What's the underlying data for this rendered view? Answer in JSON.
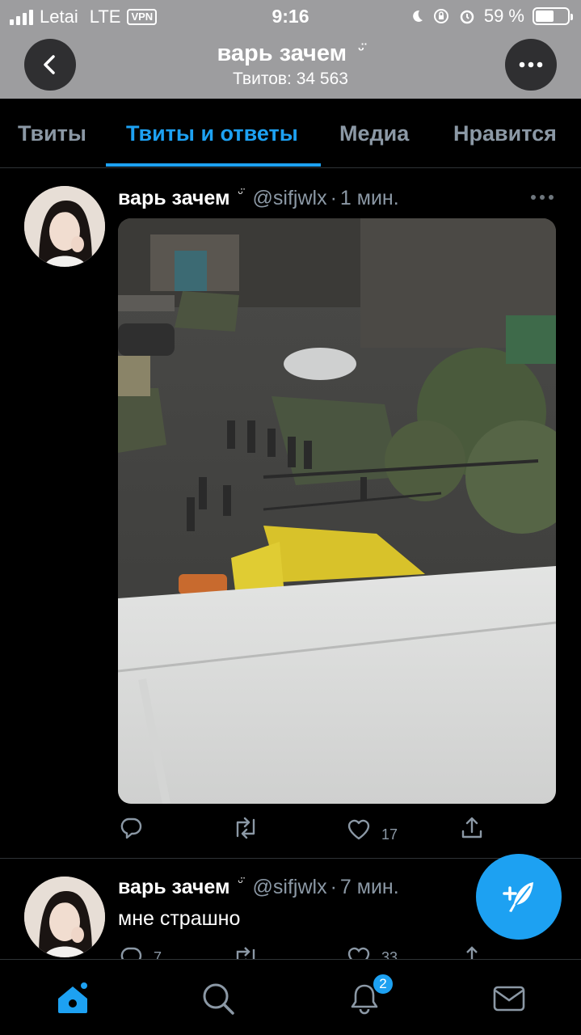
{
  "status_bar": {
    "carrier": "Letai",
    "network": "LTE",
    "vpn": "VPN",
    "time": "9:16",
    "battery": "59 %",
    "battery_level": 0.59
  },
  "header": {
    "title": "варь зачем",
    "title_badge": "ᵕ̈",
    "subtitle": "Твитов: 34 563"
  },
  "tabs": [
    {
      "label": "Твиты"
    },
    {
      "label": "Твиты и ответы",
      "active": true
    },
    {
      "label": "Медиа"
    },
    {
      "label": "Нравится"
    }
  ],
  "tweets": [
    {
      "name": "варь зачем",
      "badge": "ᵕ̈",
      "handle": "@sifjwlx",
      "separator": "·",
      "time": "1 мин.",
      "text": "",
      "media": "photo",
      "like_count": "17"
    },
    {
      "name": "варь зачем",
      "badge": "ᵕ̈",
      "handle": "@sifjwlx",
      "separator": "·",
      "time": "7 мин.",
      "text": "мне страшно",
      "reply_count": "7",
      "like_count": "33"
    }
  ],
  "bottom_nav": {
    "notifications_badge": "2"
  },
  "colors": {
    "accent": "#1da1f2",
    "muted": "#8b98a5",
    "header_bg": "#9d9d9f",
    "background": "#000000"
  }
}
